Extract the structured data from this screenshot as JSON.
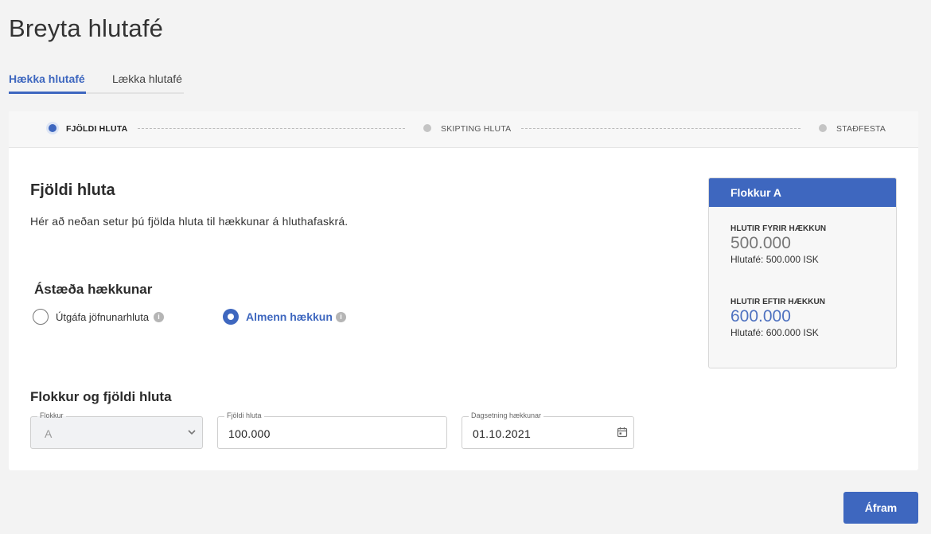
{
  "page": {
    "title": "Breyta hlutafé"
  },
  "tabs": [
    {
      "label": "Hækka hlutafé",
      "active": true
    },
    {
      "label": "Lækka hlutafé",
      "active": false
    }
  ],
  "stepper": {
    "steps": [
      {
        "label": "FJÖLDI HLUTA",
        "active": true
      },
      {
        "label": "SKIPTING HLUTA",
        "active": false
      },
      {
        "label": "STAÐFESTA",
        "active": false
      }
    ]
  },
  "main": {
    "title": "Fjöldi hluta",
    "intro": "Hér að neðan setur þú fjölda hluta til hækkunar á hluthafaskrá.",
    "reason": {
      "title": "Ástæða hækkunar",
      "options": [
        {
          "label": "Útgáfa jöfnunarhluta",
          "selected": false
        },
        {
          "label": "Almenn hækkun",
          "selected": true
        }
      ]
    },
    "class_section": {
      "title": "Flokkur og fjöldi hluta",
      "class_field": {
        "label": "Flokkur",
        "value": "A"
      },
      "count_field": {
        "label": "Fjöldi hluta",
        "value": "100.000"
      },
      "date_field": {
        "label": "Dagsetning hækkunar",
        "value": "01.10.2021"
      }
    }
  },
  "summary": {
    "title": "Flokkur A",
    "before": {
      "label": "HLUTIR FYRIR HÆKKUN",
      "value": "500.000",
      "capital": "Hlutafé: 500.000 ISK"
    },
    "after": {
      "label": "HLUTIR EFTIR HÆKKUN",
      "value": "600.000",
      "capital": "Hlutafé: 600.000 ISK"
    }
  },
  "actions": {
    "next_label": "Áfram"
  },
  "colors": {
    "accent": "#3e67bf",
    "background": "#f3f3f3"
  }
}
